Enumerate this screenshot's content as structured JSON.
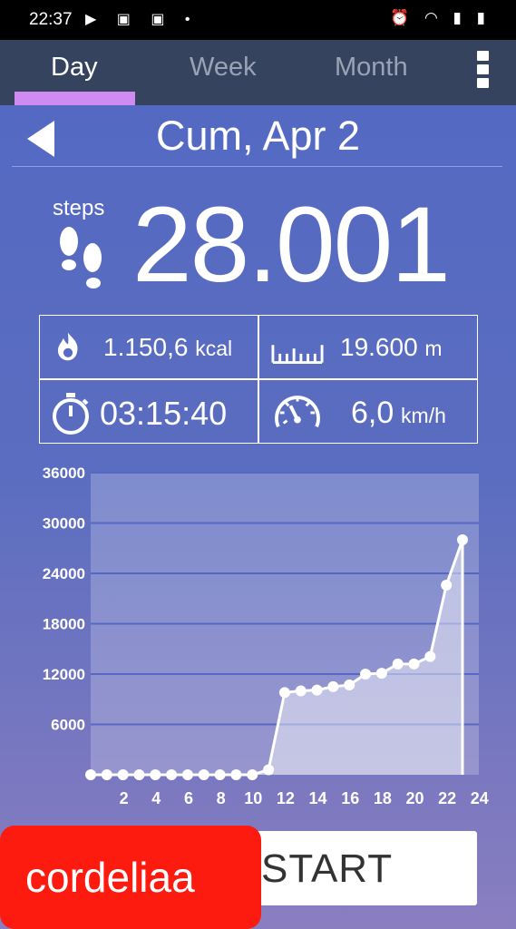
{
  "status_bar": {
    "time": "22:37",
    "left_icons": "▶ ▣ ▣ •",
    "right_icons": "⏰ ◠ ▮ ▮"
  },
  "tabs": [
    {
      "label": "Day",
      "active": true
    },
    {
      "label": "Week",
      "active": false
    },
    {
      "label": "Month",
      "active": false
    }
  ],
  "header": {
    "date": "Cum, Apr 2"
  },
  "steps": {
    "label": "steps",
    "value": "28.001"
  },
  "stats": {
    "calories": {
      "value": "1.150,6",
      "unit": "kcal",
      "icon": "fire-icon"
    },
    "distance": {
      "value": "19.600",
      "unit": "m",
      "icon": "ruler-icon"
    },
    "duration": {
      "value": "03:15:40",
      "icon": "stopwatch-icon"
    },
    "speed": {
      "value": "6,0",
      "unit": "km/h",
      "icon": "speedometer-icon"
    }
  },
  "chart_data": {
    "type": "area",
    "x": [
      0,
      1,
      2,
      3,
      4,
      5,
      6,
      7,
      8,
      9,
      10,
      11,
      12,
      13,
      14,
      15,
      16,
      17,
      18,
      19,
      20,
      21,
      22,
      23
    ],
    "values": [
      0,
      0,
      0,
      0,
      0,
      0,
      0,
      0,
      0,
      0,
      0,
      600,
      9800,
      10000,
      10100,
      10500,
      10700,
      12000,
      12100,
      13200,
      13200,
      14100,
      22600,
      28001
    ],
    "x_tick_labels": [
      "2",
      "4",
      "6",
      "8",
      "10",
      "12",
      "14",
      "16",
      "18",
      "20",
      "22",
      "24"
    ],
    "y_tick_labels": [
      "6000",
      "12000",
      "18000",
      "24000",
      "30000",
      "36000"
    ],
    "ylim": [
      0,
      36000
    ],
    "xlim": [
      0,
      24
    ],
    "grid": true
  },
  "start_button": {
    "label": "START"
  },
  "overlay": {
    "name": "cordeliaa"
  },
  "colors": {
    "accent": "#cf8bf2",
    "tabbar": "#36435f",
    "badge": "#fd1a0f"
  }
}
